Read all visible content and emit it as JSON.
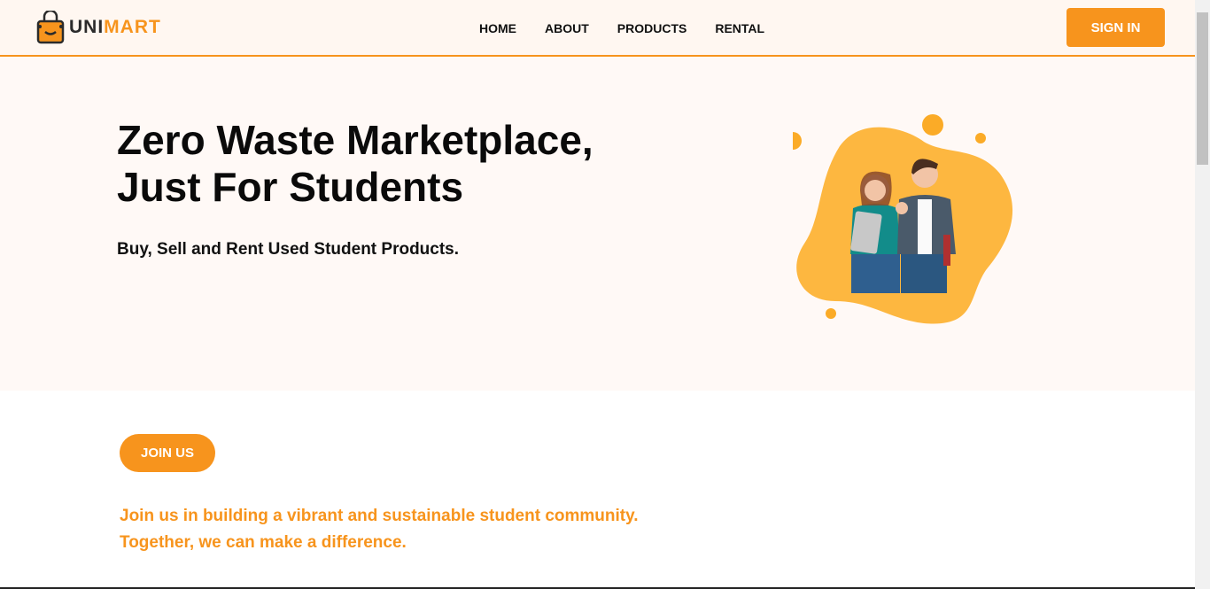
{
  "brand": {
    "part1": "UNI",
    "part2": "MART"
  },
  "nav": [
    {
      "label": "HOME"
    },
    {
      "label": "ABOUT"
    },
    {
      "label": "PRODUCTS"
    },
    {
      "label": "RENTAL"
    }
  ],
  "signin_label": "SIGN IN",
  "hero": {
    "title_line1": "Zero Waste Marketplace,",
    "title_line2": "Just For Students",
    "subtitle": "Buy, Sell and Rent Used Student Products."
  },
  "join": {
    "button": "JOIN US",
    "line1": "Join us in building a vibrant and sustainable student community.",
    "line2": "Together, we can make a difference."
  },
  "colors": {
    "accent": "#f7941d",
    "blob": "#fdb740"
  }
}
